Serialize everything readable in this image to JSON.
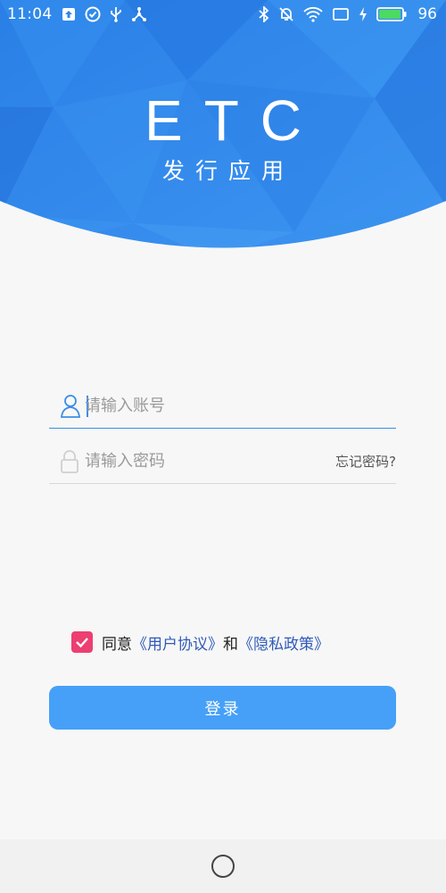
{
  "status_bar": {
    "time": "11:04",
    "battery_level": "96",
    "battery_fill": 0.96,
    "battery_color": "#4cd964",
    "icons_left": [
      "upload-icon",
      "check-circle-icon",
      "usb-icon",
      "share-icon"
    ],
    "icons_right": [
      "bluetooth-icon",
      "mute-icon",
      "wifi-icon",
      "screen-icon",
      "charging-icon",
      "battery-icon"
    ]
  },
  "header": {
    "title": "ETC",
    "subtitle": "发行应用",
    "bg_color": "#2f86ea"
  },
  "form": {
    "account_placeholder": "请输入账号",
    "password_placeholder": "请输入密码",
    "forgot_label": "忘记密码?",
    "account_icon": "user-icon",
    "password_icon": "lock-icon",
    "accent_color": "#3b8ee8"
  },
  "agreement": {
    "checked": true,
    "prefix": "同意",
    "user_agreement": "《用户协议》",
    "and": "和",
    "privacy_policy": "《隐私政策》",
    "checkbox_color": "#ec3f72",
    "link_color": "#2f5ab8"
  },
  "login": {
    "label": "登录",
    "color": "#46a0f7"
  },
  "navbar": {
    "home_icon": "home-circle-icon"
  }
}
